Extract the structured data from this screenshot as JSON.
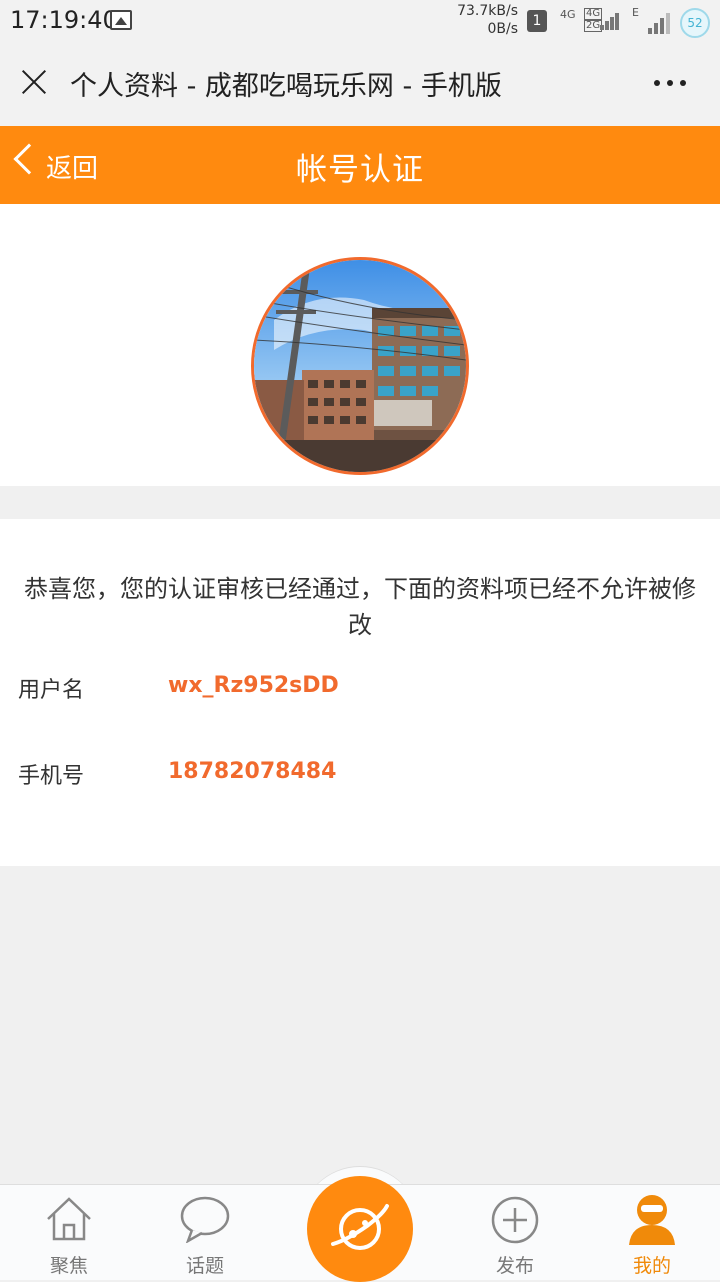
{
  "status_bar": {
    "time": "17:19:40",
    "net_up": "73.7kB/s",
    "net_down": "0B/s",
    "sim_slot": "1",
    "net_type_1": "4G",
    "net_type_2a": "4G",
    "net_type_2b": "2G",
    "net_type_3": "E",
    "badge": "52"
  },
  "title_bar": {
    "title": "个人资料 - 成都吃喝玩乐网 - 手机版"
  },
  "header": {
    "back_label": "返回",
    "title": "帐号认证"
  },
  "info": {
    "notice": "恭喜您，您的认证审核已经通过，下面的资料项已经不允许被修改",
    "rows": [
      {
        "label": "用户名",
        "value": "wx_Rz952sDD"
      },
      {
        "label": "手机号",
        "value": "18782078484"
      }
    ]
  },
  "tabs": [
    {
      "label": "聚焦",
      "icon": "home-icon",
      "active": false
    },
    {
      "label": "话题",
      "icon": "chat-bubble-icon",
      "active": false
    },
    {
      "label": "",
      "icon": "planet-icon",
      "active": false
    },
    {
      "label": "发布",
      "icon": "plus-circle-icon",
      "active": false
    },
    {
      "label": "我的",
      "icon": "user-icon",
      "active": true
    }
  ],
  "colors": {
    "accent": "#ff8a0f",
    "value_text": "#f16a2d",
    "active_tab": "#f08a0a"
  }
}
